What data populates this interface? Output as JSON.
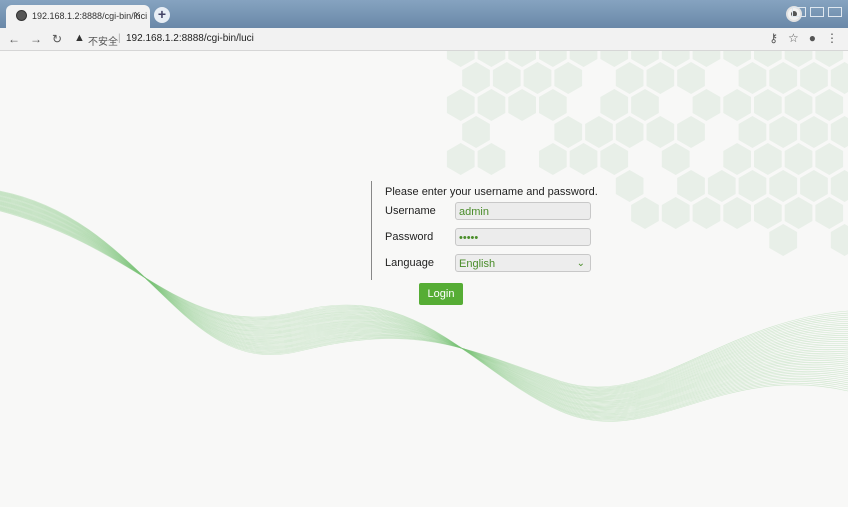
{
  "browser": {
    "tab_title": "192.168.1.2:8888/cgi-bin/luci",
    "tab_close": "×",
    "new_tab": "+",
    "security_warning": "▲",
    "insecure_label": "不安全",
    "separator": "|",
    "url": "192.168.1.2:8888/cgi-bin/luci"
  },
  "login": {
    "prompt": "Please enter your username and password.",
    "username_label": "Username",
    "username_value": "admin",
    "password_label": "Password",
    "password_value": "•••••",
    "language_label": "Language",
    "language_value": "English",
    "login_button": "Login"
  },
  "colors": {
    "accent_green": "#56ad35",
    "hexagon": "#e8efe8",
    "wave": "#7fc57a"
  }
}
